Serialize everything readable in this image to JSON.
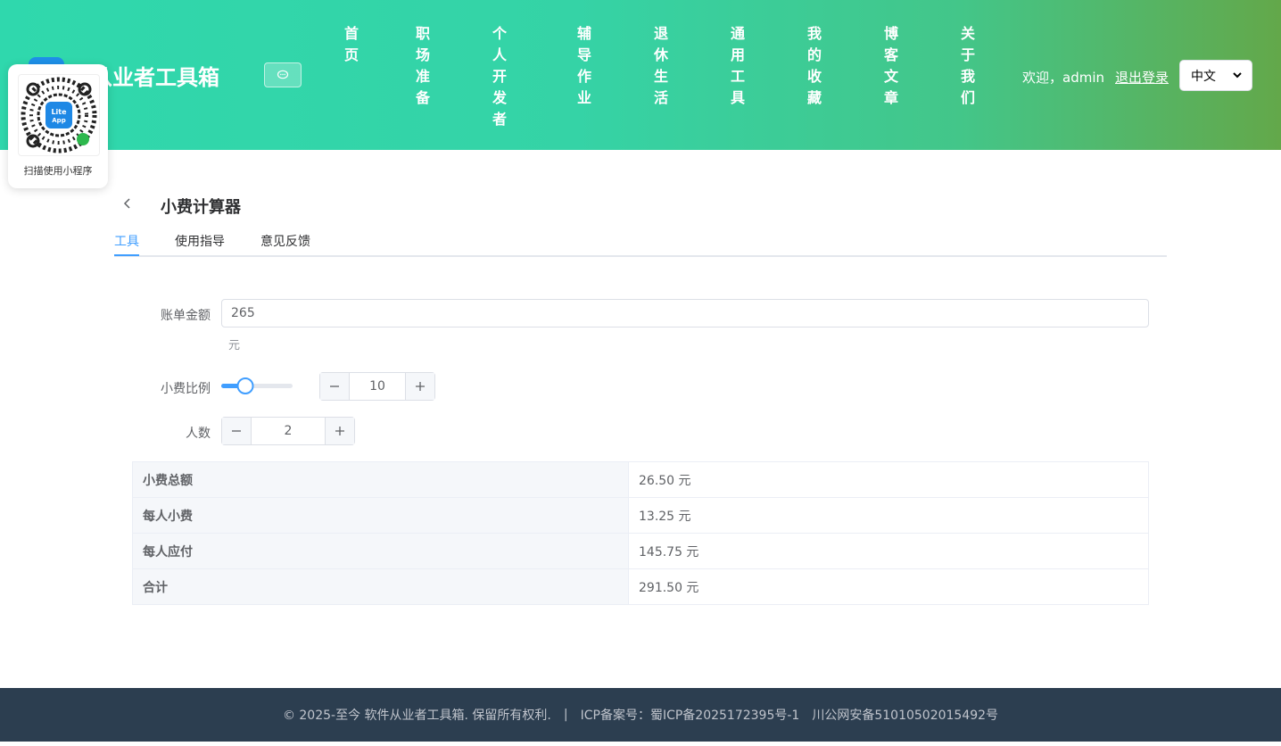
{
  "header": {
    "brand_title": "件从业者工具箱",
    "nav": [
      "首页",
      "职场准备",
      "个人开发者",
      "辅导作业",
      "退休生活",
      "通用工具",
      "我的收藏",
      "博客文章",
      "关于我们"
    ],
    "welcome": "欢迎，admin",
    "logout": "退出登录",
    "language": "中文"
  },
  "qr": {
    "caption": "扫描使用小程序"
  },
  "page": {
    "title": "小费计算器"
  },
  "tabs": [
    "工具",
    "使用指导",
    "意见反馈"
  ],
  "form": {
    "bill_label": "账单金额",
    "bill_value": "265",
    "bill_unit": "元",
    "tip_label": "小费比例",
    "tip_value": "10",
    "tip_percent": 10,
    "tip_max": 30,
    "people_label": "人数",
    "people_value": "2"
  },
  "results": [
    {
      "label": "小费总额",
      "value": "26.50 元"
    },
    {
      "label": "每人小费",
      "value": "13.25 元"
    },
    {
      "label": "每人应付",
      "value": "145.75 元"
    },
    {
      "label": "合计",
      "value": "291.50 元"
    }
  ],
  "footer": {
    "copyright": "© 2025-至今 软件从业者工具箱. 保留所有权利.",
    "separator": "|",
    "icp": "ICP备案号：蜀ICP备2025172395号-1",
    "police": "川公网安备51010502015492号"
  },
  "colors": {
    "accent": "#409eff",
    "header_start": "#2fd8ad",
    "header_end": "#63a84a",
    "footer_bg": "#2c3e50"
  }
}
